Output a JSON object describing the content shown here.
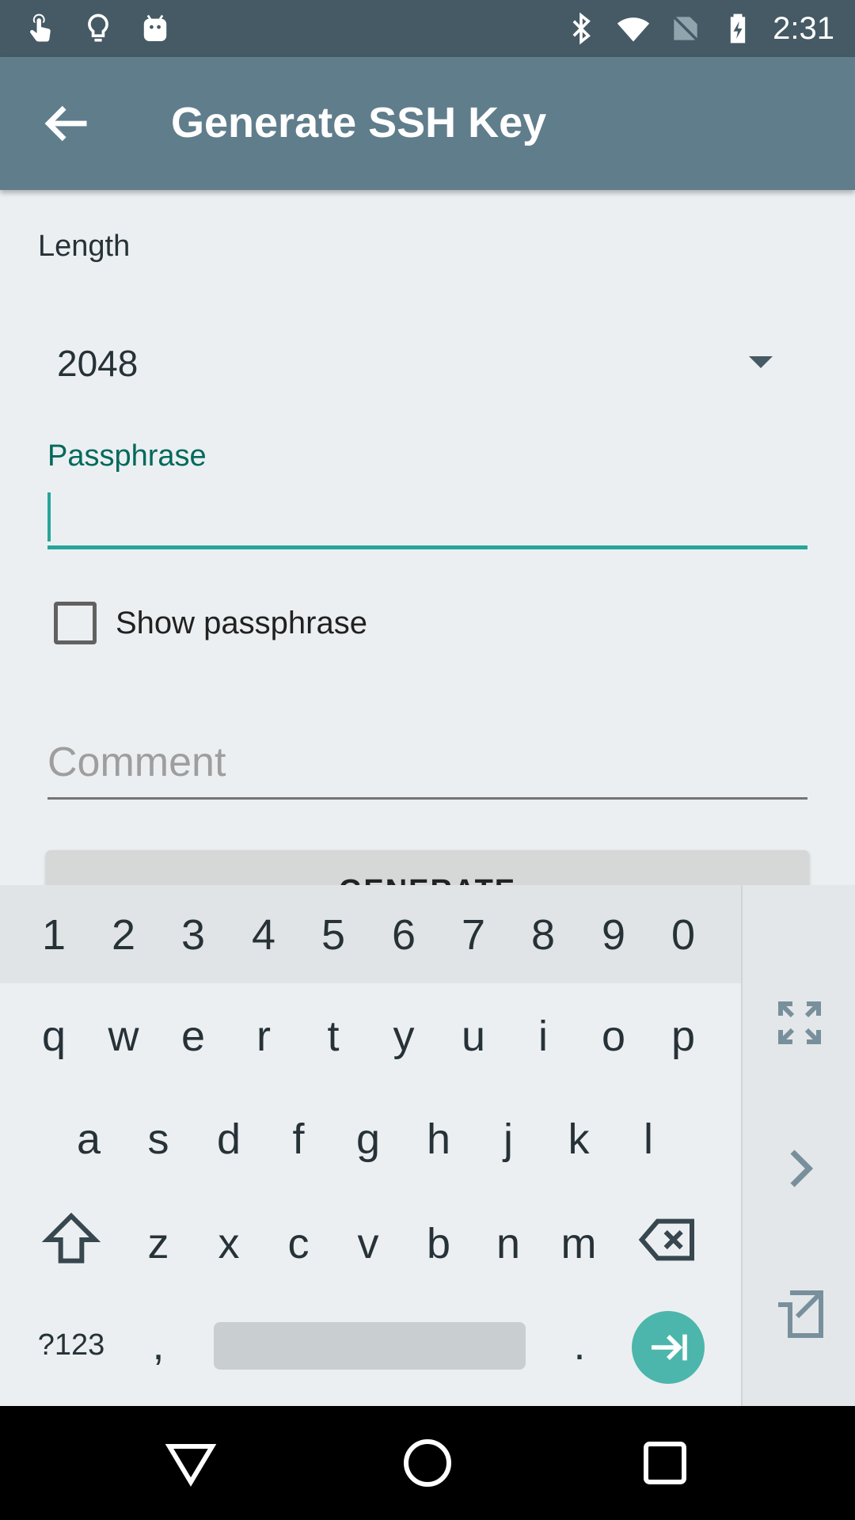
{
  "status_bar": {
    "time": "2:31",
    "left_icons": [
      "touch-icon",
      "lightbulb-icon",
      "android-icon"
    ],
    "right_icons": [
      "bluetooth-icon",
      "wifi-icon",
      "no-sim-icon",
      "battery-charging-icon"
    ]
  },
  "app_bar": {
    "title": "Generate SSH Key",
    "back_icon": "arrow-back-icon"
  },
  "form": {
    "length_label": "Length",
    "length_value": "2048",
    "passphrase_label": "Passphrase",
    "passphrase_value": "",
    "show_passphrase_label": "Show passphrase",
    "show_passphrase_checked": false,
    "comment_placeholder": "Comment",
    "generate_label": "GENERATE"
  },
  "keyboard": {
    "number_row": [
      "1",
      "2",
      "3",
      "4",
      "5",
      "6",
      "7",
      "8",
      "9",
      "0"
    ],
    "row1": [
      "q",
      "w",
      "e",
      "r",
      "t",
      "y",
      "u",
      "i",
      "o",
      "p"
    ],
    "row2": [
      "a",
      "s",
      "d",
      "f",
      "g",
      "h",
      "j",
      "k",
      "l"
    ],
    "row3": [
      "z",
      "x",
      "c",
      "v",
      "b",
      "n",
      "m"
    ],
    "symbols_key": "?123",
    "comma_key": ",",
    "period_key": ".",
    "side_icons": [
      "fullscreen-icon",
      "chevron-right-icon",
      "popout-icon"
    ]
  },
  "nav_bar": {
    "icons": [
      "back-triangle-icon",
      "home-circle-icon",
      "recents-square-icon"
    ]
  },
  "colors": {
    "status_bar": "#455a64",
    "app_bar": "#607d8b",
    "accent": "#26a69a",
    "passphrase_label": "#00695c",
    "enter_key": "#4db6ac"
  }
}
